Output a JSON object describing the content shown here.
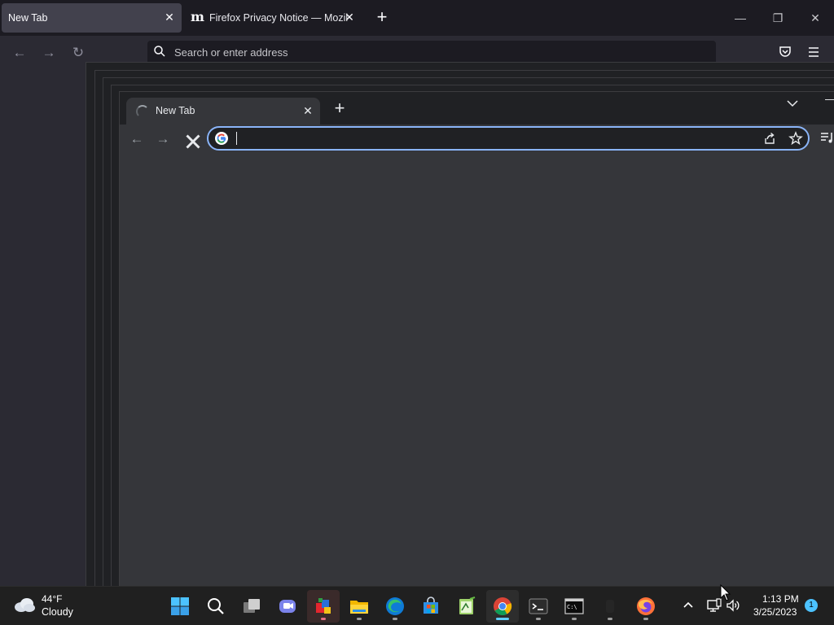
{
  "firefox": {
    "tabs": [
      {
        "label": "New Tab",
        "active": true
      },
      {
        "label": "Firefox Privacy Notice — Mozilla",
        "active": false
      }
    ],
    "close_glyph": "✕",
    "newtab_glyph": "+",
    "url_placeholder": "Search or enter address",
    "icons": [
      "back-icon",
      "forward-icon",
      "reload-icon",
      "search-icon",
      "pocket-icon",
      "hamburger-menu-icon"
    ]
  },
  "chrome": {
    "tab": {
      "title": "New Tab",
      "loading": true
    },
    "close_glyph": "✕",
    "newtab_glyph": "+",
    "omnibox_value": "",
    "accent_color": "#8ab4f8",
    "icons": [
      "back-icon",
      "forward-icon",
      "stop-icon",
      "google-g-icon",
      "share-icon",
      "star-icon",
      "media-control-icon",
      "tab-search-icon"
    ]
  },
  "window_controls": {
    "minimize": "—",
    "maximize": "❐",
    "close": "✕"
  },
  "taskbar": {
    "weather": {
      "temp": "44°F",
      "condition": "Cloudy"
    },
    "apps": [
      "start",
      "search",
      "task-view",
      "chat",
      "illustrator",
      "file-explorer",
      "edge",
      "store",
      "notepad-plus-plus",
      "chrome",
      "terminal",
      "cmd",
      "blank",
      "firefox"
    ],
    "active_app": "chrome",
    "clock": {
      "time": "1:13 PM",
      "date": "3/25/2023"
    },
    "notification_count": "1"
  }
}
